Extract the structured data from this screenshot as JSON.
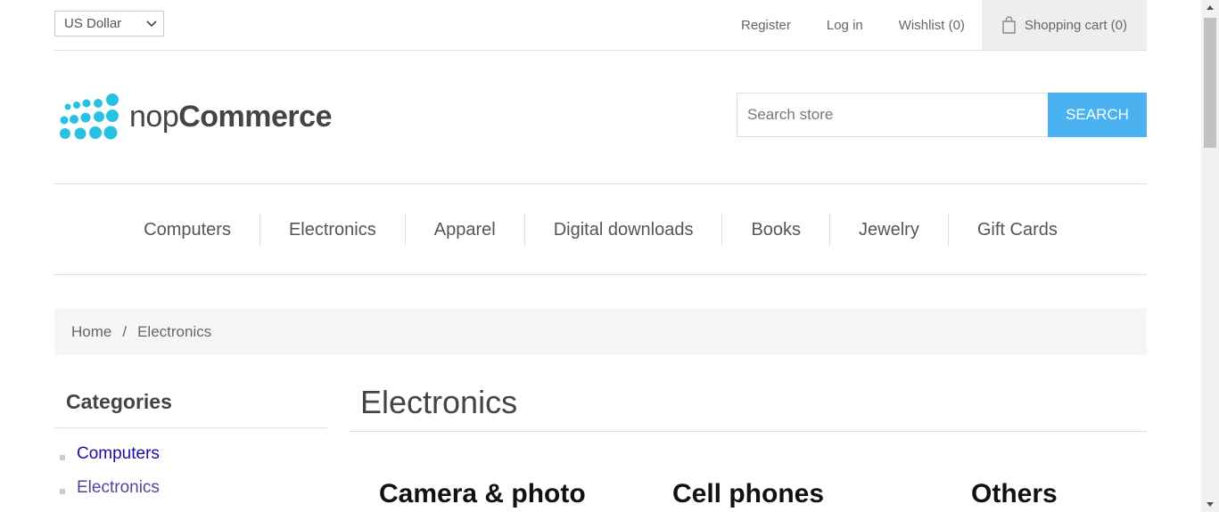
{
  "header": {
    "currency": {
      "selected": "US Dollar"
    },
    "links": {
      "register": "Register",
      "login": "Log in",
      "wishlist": "Wishlist (0)",
      "cart": "Shopping cart (0)"
    }
  },
  "logo": {
    "text_light": "nop",
    "text_bold": "Commerce",
    "dot_color": "#27c2e3"
  },
  "search": {
    "placeholder": "Search store",
    "button": "Search",
    "button_color": "#4ab2f1"
  },
  "menu": {
    "items": [
      "Computers",
      "Electronics",
      "Apparel",
      "Digital downloads",
      "Books",
      "Jewelry",
      "Gift Cards"
    ]
  },
  "breadcrumb": {
    "home": "Home",
    "separator": "/",
    "current": "Electronics"
  },
  "sidebar": {
    "title": "Categories",
    "items": [
      "Computers",
      "Electronics"
    ]
  },
  "main": {
    "title": "Electronics",
    "subcategories": [
      "Camera & photo",
      "Cell phones",
      "Others"
    ]
  }
}
